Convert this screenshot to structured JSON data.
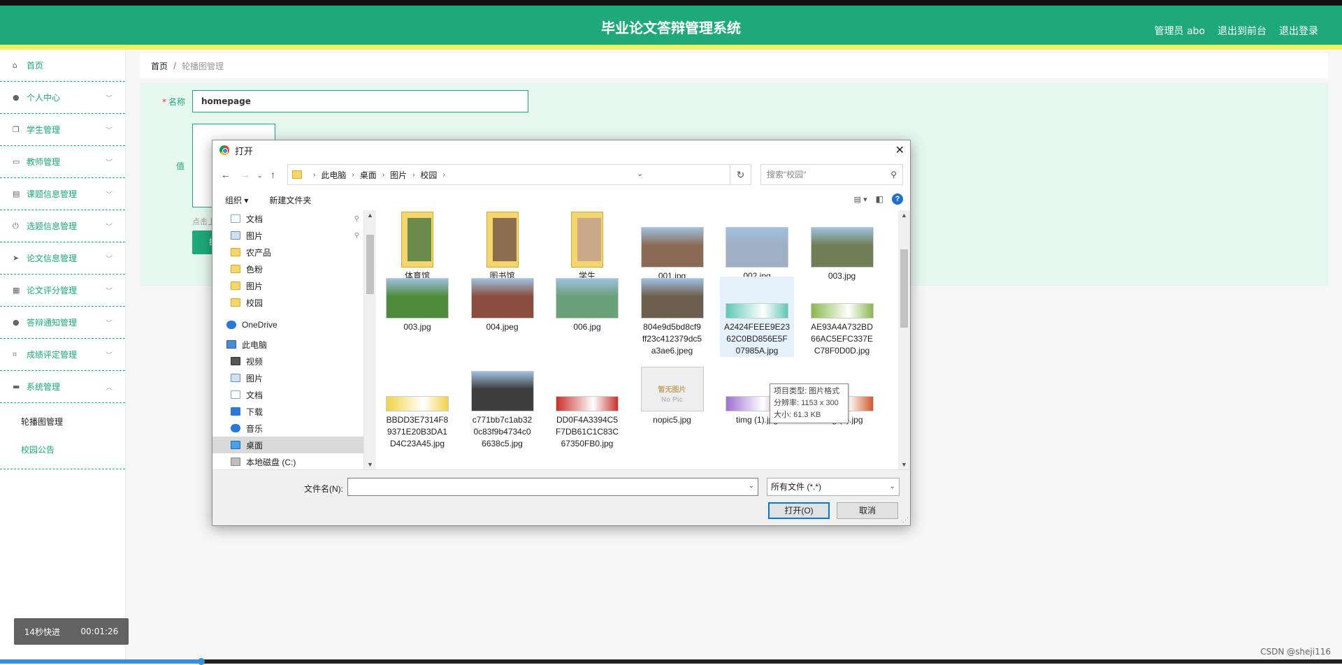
{
  "app": {
    "title": "毕业论文答辩管理系统",
    "admin_label": "管理员 abo",
    "back_label": "退出到前台",
    "logout_label": "退出登录"
  },
  "sidebar": {
    "items": [
      {
        "label": "首页",
        "icon": "home-icon"
      },
      {
        "label": "个人中心",
        "icon": "user-icon"
      },
      {
        "label": "学生管理",
        "icon": "copy-icon"
      },
      {
        "label": "教师管理",
        "icon": "id-card-icon"
      },
      {
        "label": "课题信息管理",
        "icon": "book-icon"
      },
      {
        "label": "选题信息管理",
        "icon": "power-icon"
      },
      {
        "label": "论文信息管理",
        "icon": "send-icon"
      },
      {
        "label": "论文评分管理",
        "icon": "clipboard-icon"
      },
      {
        "label": "答辩通知管理",
        "icon": "user-icon"
      },
      {
        "label": "成绩评定管理",
        "icon": "crop-icon"
      },
      {
        "label": "系统管理",
        "icon": "chat-icon"
      }
    ],
    "submenu": [
      {
        "label": "轮播图管理",
        "active": true
      },
      {
        "label": "校园公告",
        "active": false
      }
    ]
  },
  "breadcrumb": {
    "home": "首页",
    "separator": "/",
    "current": "轮播图管理"
  },
  "form": {
    "name_label": "名称",
    "name_value": "homepage",
    "value_label": "值",
    "hint": "点击上",
    "submit_label": "提"
  },
  "player": {
    "speed": "14秒快进",
    "time": "00:01:26",
    "progress": 0.15
  },
  "watermark": "CSDN @sheji116",
  "dialog": {
    "title": "打开",
    "path": [
      "此电脑",
      "桌面",
      "图片",
      "校园"
    ],
    "search_placeholder": "搜索\"校园\"",
    "organize_label": "组织 ▾",
    "new_folder_label": "新建文件夹",
    "tree": [
      {
        "label": "文档",
        "icon": "document-icon",
        "pinned": true
      },
      {
        "label": "图片",
        "icon": "pictures-icon",
        "pinned": true
      },
      {
        "label": "农产品",
        "icon": "folder-icon",
        "pinned": false
      },
      {
        "label": "色粉",
        "icon": "folder-icon",
        "pinned": false
      },
      {
        "label": "图片",
        "icon": "folder-icon",
        "pinned": false
      },
      {
        "label": "校园",
        "icon": "folder-icon",
        "pinned": false
      },
      {
        "label": "OneDrive",
        "icon": "cloud-icon",
        "pinned": false
      },
      {
        "label": "此电脑",
        "icon": "computer-icon",
        "pinned": false
      },
      {
        "label": "视频",
        "icon": "video-icon",
        "pinned": false
      },
      {
        "label": "图片",
        "icon": "pictures-icon",
        "pinned": false
      },
      {
        "label": "文档",
        "icon": "document-icon",
        "pinned": false
      },
      {
        "label": "下载",
        "icon": "download-icon",
        "pinned": false
      },
      {
        "label": "音乐",
        "icon": "music-icon",
        "pinned": false
      },
      {
        "label": "桌面",
        "icon": "desktop-icon",
        "pinned": false,
        "selected": true
      },
      {
        "label": "本地磁盘 (C:)",
        "icon": "drive-icon",
        "pinned": false
      }
    ],
    "files": [
      {
        "name": "体育馆",
        "kind": "folder",
        "color": "#6a8a4a"
      },
      {
        "name": "图书馆",
        "kind": "folder",
        "color": "#8a6e4e"
      },
      {
        "name": "学生",
        "kind": "folder",
        "color": "#c9a98a"
      },
      {
        "name": "001.jpg",
        "kind": "image",
        "color": "#8b6a55"
      },
      {
        "name": "002.jpg",
        "kind": "image",
        "color": "#9fb0c4"
      },
      {
        "name": "003.jpg",
        "kind": "image",
        "color": "#6f7f55"
      },
      {
        "name": "003.jpg",
        "kind": "image",
        "color": "#4f8a3a"
      },
      {
        "name": "004.jpeg",
        "kind": "image",
        "color": "#8a4e3e"
      },
      {
        "name": "006.jpg",
        "kind": "image",
        "color": "#6aa07a"
      },
      {
        "name": "804e9d5bd8cf9\nff23c412379dc5\na3ae6.jpeg",
        "kind": "image",
        "color": "#6e5e4e"
      },
      {
        "name": "A2424FEEE9E23\n62C0BD856E5F\n07985A.jpg",
        "kind": "banner",
        "color": "#5fc8b8",
        "hovered": true
      },
      {
        "name": "AE93A4A732BD\n66AC5EFC337E\nC78F0D0D.jpg",
        "kind": "banner",
        "color": "#8ab84e"
      },
      {
        "name": "BBDD3E7314F8\n9371E20B3DA1\nD4C23A45.jpg",
        "kind": "banner",
        "color": "#f0d24a"
      },
      {
        "name": "c771bb7c1ab32\n0c83f9b4734c0\n6638c5.jpg",
        "kind": "image",
        "color": "#3e3e3e"
      },
      {
        "name": "DD0F4A3394C5\nF7DB61C1C83C\n67350FB0.jpg",
        "kind": "banner",
        "color": "#c8322e"
      },
      {
        "name": "nopic5.jpg",
        "kind": "nopic",
        "color": "#eeeeee"
      },
      {
        "name": "timg (1).jpg",
        "kind": "banner",
        "color": "#a070d0"
      },
      {
        "name": "timg (2).jpg",
        "kind": "banner",
        "color": "#d05a2a"
      }
    ],
    "nopic_text": "暂无图片",
    "nopic_sub": "No Pic",
    "tooltip": [
      "项目类型: 图片格式",
      "分辨率: 1153 x 300",
      "大小: 61.3 KB"
    ],
    "filename_label": "文件名(N):",
    "filename_value": "",
    "filetype_value": "所有文件 (*.*)",
    "open_label": "打开(O)",
    "cancel_label": "取消"
  }
}
